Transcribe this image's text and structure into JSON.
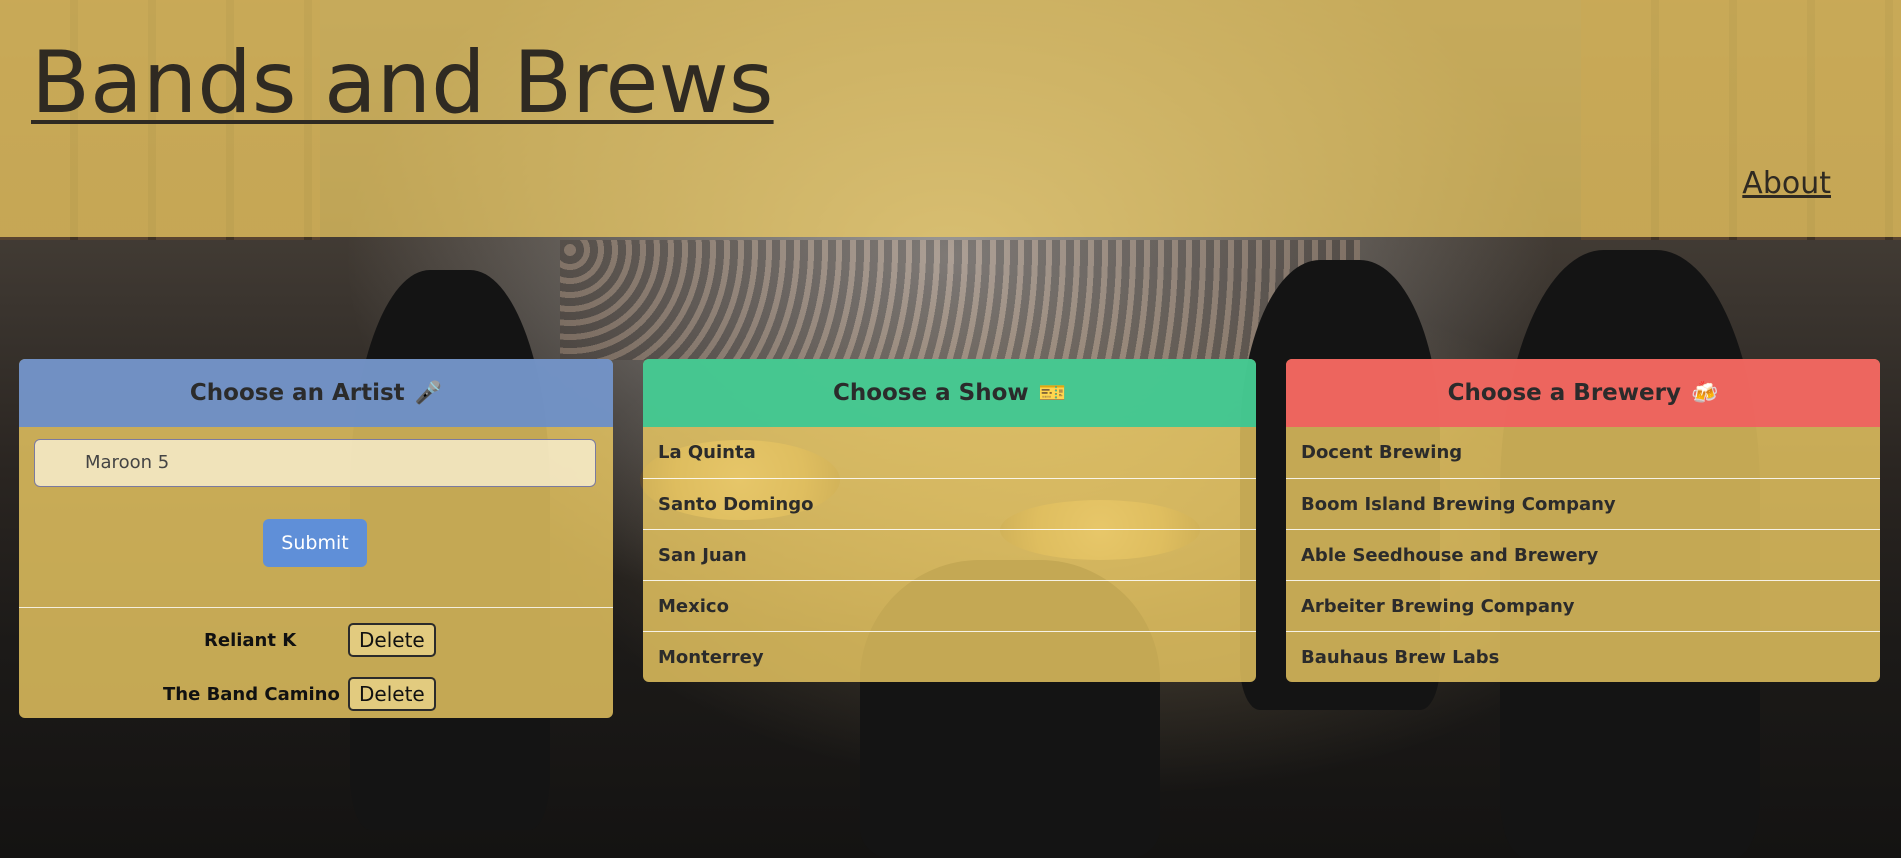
{
  "header": {
    "title": "Bands and Brews",
    "about_label": "About"
  },
  "artist_card": {
    "title": "Choose an Artist",
    "icon": "🎤",
    "input_value": "Maroon 5",
    "submit_label": "Submit",
    "artists": [
      {
        "name": "Reliant K",
        "delete_label": "Delete"
      },
      {
        "name": "The Band Camino",
        "delete_label": "Delete"
      }
    ]
  },
  "show_card": {
    "title": "Choose a Show",
    "icon": "🎫",
    "shows": [
      "La Quinta",
      "Santo Domingo",
      "San Juan",
      "Mexico",
      "Monterrey"
    ]
  },
  "brewery_card": {
    "title": "Choose a Brewery",
    "icon": "🍻",
    "breweries": [
      "Docent Brewing",
      "Boom Island Brewing Company",
      "Able Seedhouse and Brewery",
      "Arbeiter Brewing Company",
      "Bauhaus Brew Labs"
    ]
  },
  "colors": {
    "header_bg": "#F0CD64",
    "artist_header": "#648CD2",
    "show_header": "#32C896",
    "brewery_header": "#F05F5F",
    "submit_button": "#5F8FD8"
  }
}
